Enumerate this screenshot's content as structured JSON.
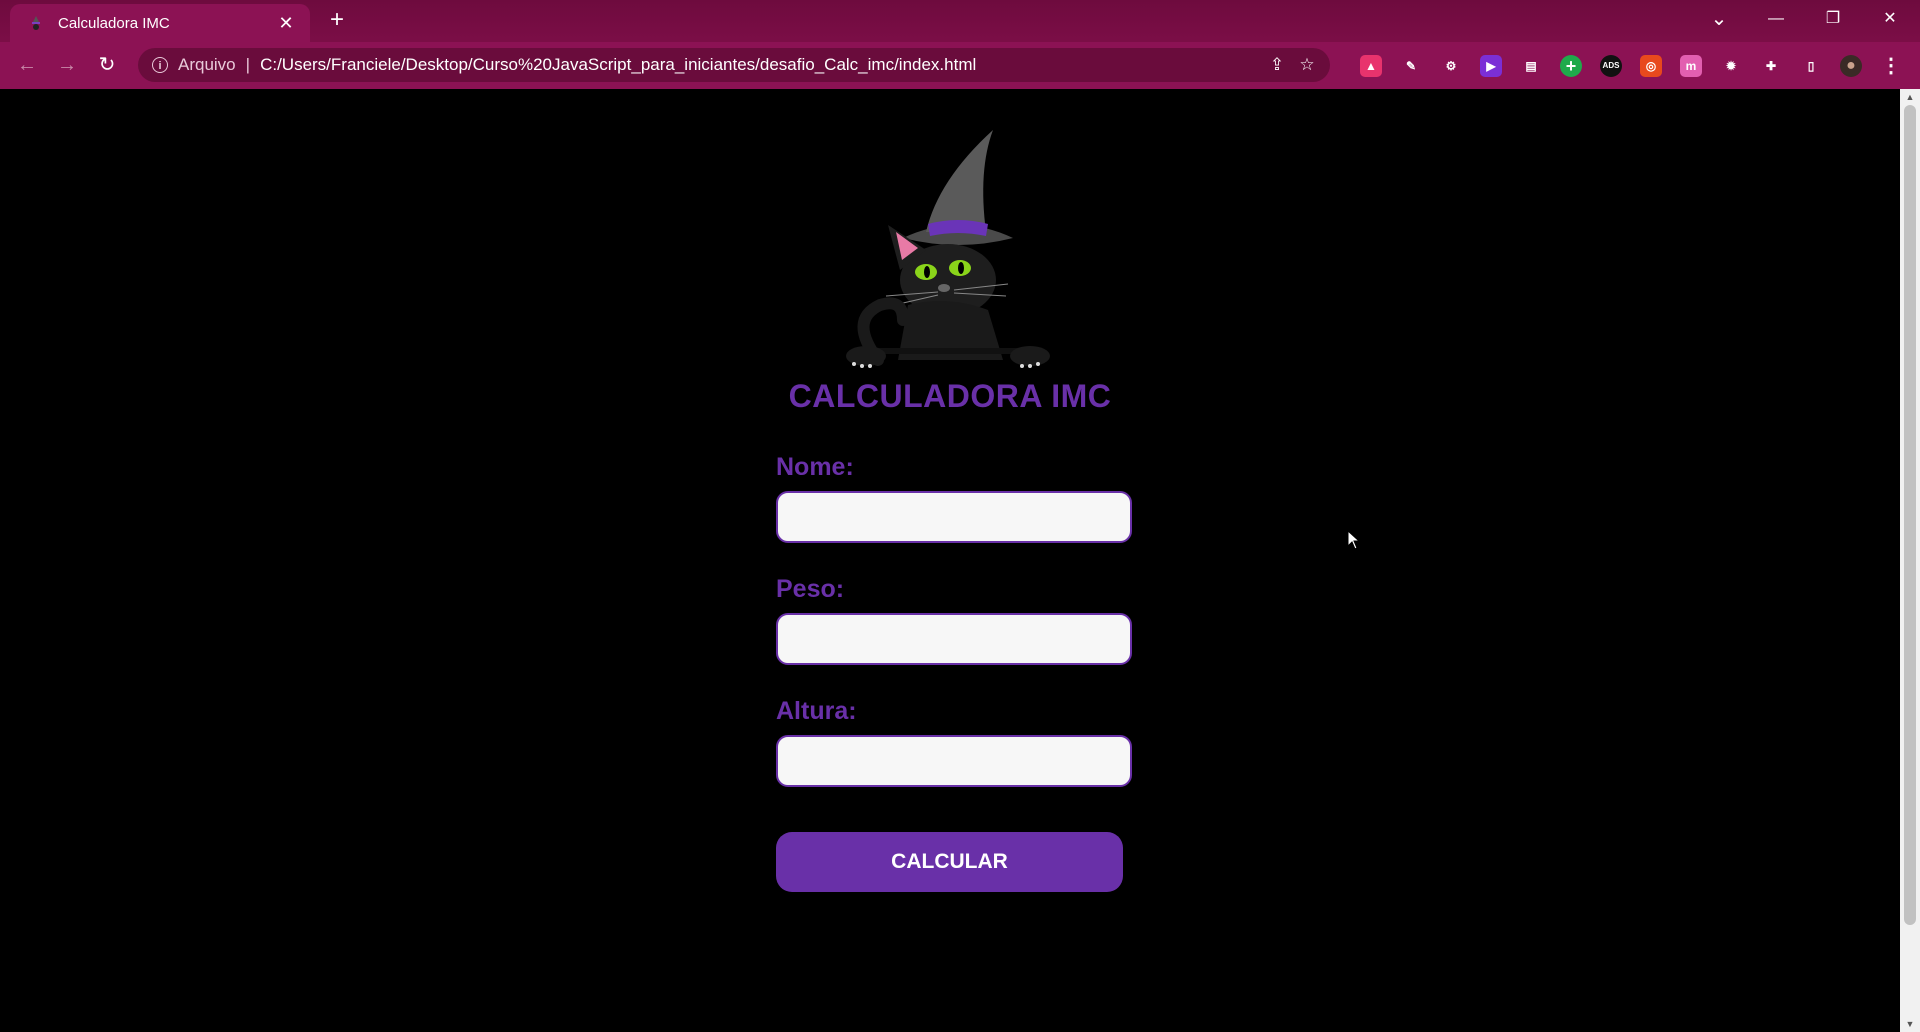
{
  "browser": {
    "tab": {
      "title": "Calculadora IMC",
      "close_glyph": "✕"
    },
    "new_tab_glyph": "+",
    "window_controls": {
      "tab_search": "⌄",
      "minimize": "—",
      "restore": "❐",
      "close": "✕"
    },
    "nav": {
      "back": "←",
      "forward": "→",
      "reload": "↻"
    },
    "address_bar": {
      "scheme_label": "Arquivo",
      "separator": "|",
      "url": "C:/Users/Franciele/Desktop/Curso%20JavaScript_para_iniciantes/desafio_Calc_imc/index.html"
    },
    "extensions": [
      {
        "icon": "profile-ext-icon",
        "glyph": "▲",
        "color": "#e8336d"
      },
      {
        "icon": "pen-ext-icon",
        "glyph": "✎",
        "color": "transparent"
      },
      {
        "icon": "gear-ext-icon",
        "glyph": "⚙",
        "color": "transparent"
      },
      {
        "icon": "video-ext-icon",
        "glyph": "▶",
        "color": "#7b2fd6"
      },
      {
        "icon": "card-ext-icon",
        "glyph": "▤",
        "color": "transparent"
      },
      {
        "icon": "plus-ext-icon",
        "glyph": "+",
        "color": "#1faa4b"
      },
      {
        "icon": "ads-ext-icon",
        "glyph": "ADS",
        "color": "#111111"
      },
      {
        "icon": "target-ext-icon",
        "glyph": "◎",
        "color": "#e8491d"
      },
      {
        "icon": "m-ext-icon",
        "glyph": "m",
        "color": "#e25fb0"
      },
      {
        "icon": "burst-ext-icon",
        "glyph": "✹",
        "color": "transparent"
      },
      {
        "icon": "puzzle-icon",
        "glyph": "✚",
        "color": "transparent"
      },
      {
        "icon": "sidepanel-icon",
        "glyph": "▯",
        "color": "transparent"
      },
      {
        "icon": "avatar",
        "glyph": "●",
        "color": "#3a2a26"
      },
      {
        "icon": "menu-icon",
        "glyph": "⋮",
        "color": "transparent"
      }
    ]
  },
  "page": {
    "title": "CALCULADORA IMC",
    "logo_icon": "witch-cat-logo",
    "fields": [
      {
        "label": "Nome:",
        "value": ""
      },
      {
        "label": "Peso:",
        "value": ""
      },
      {
        "label": "Altura:",
        "value": ""
      }
    ],
    "submit_label": "CALCULAR",
    "colors": {
      "accent": "#6930a8",
      "background": "#000000",
      "chrome": "#8c1254"
    }
  }
}
